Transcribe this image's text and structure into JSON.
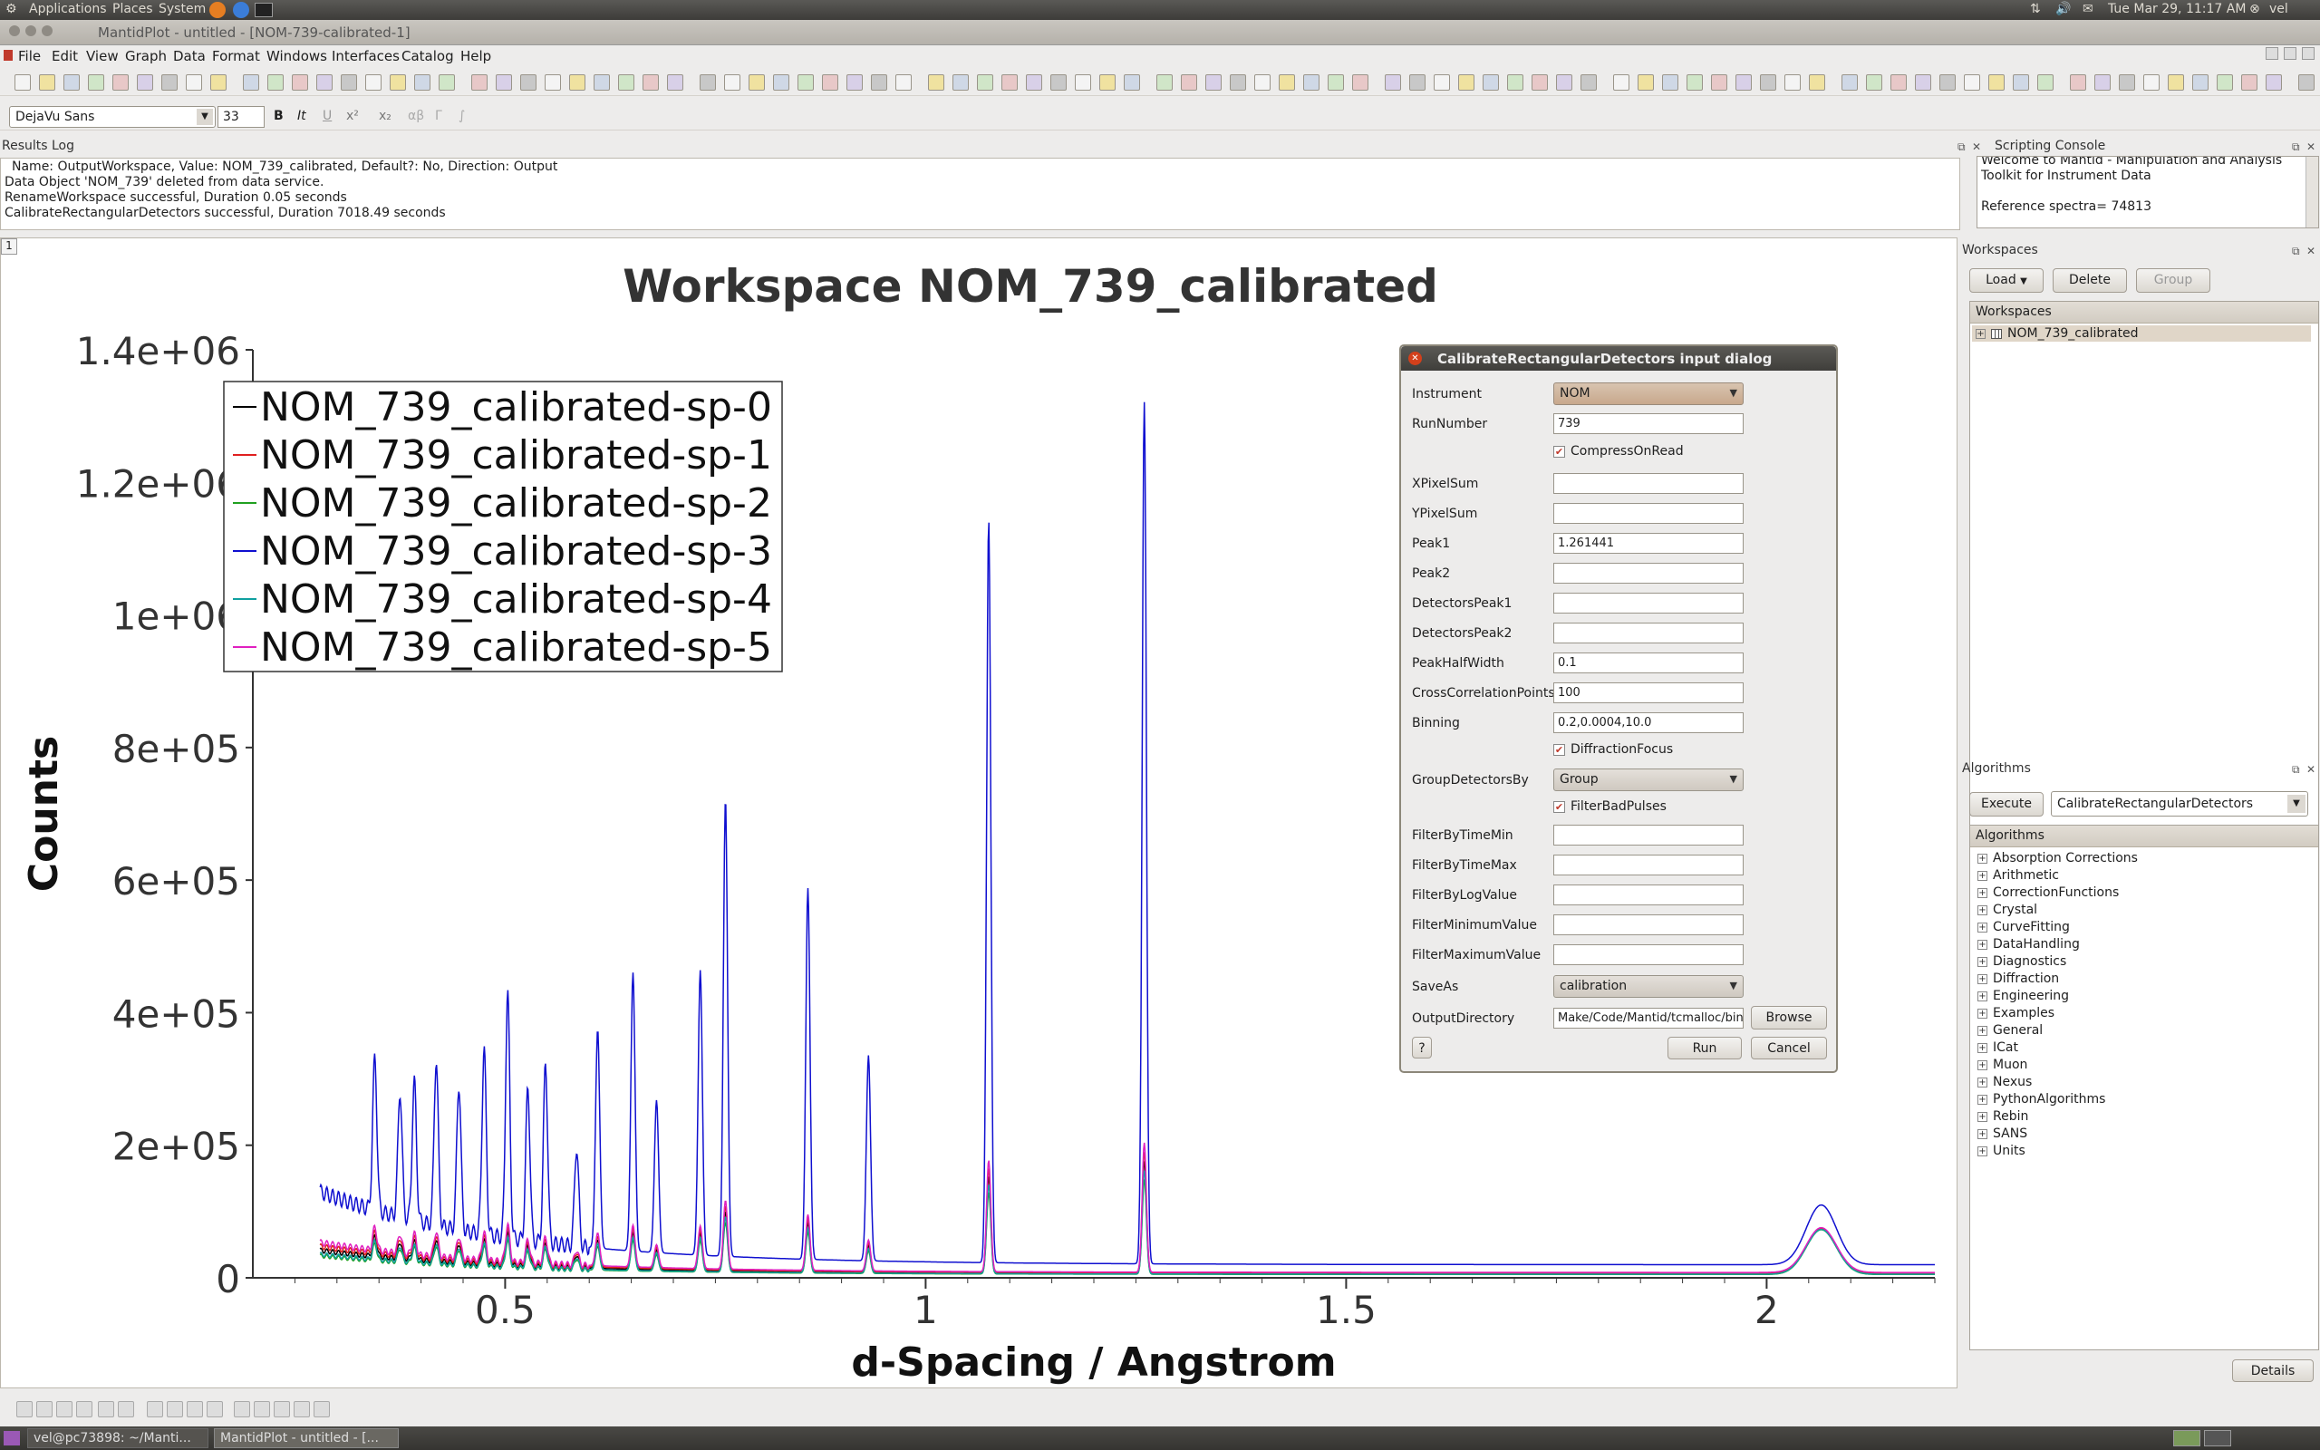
{
  "gnome_panel": {
    "menus": [
      "Applications",
      "Places",
      "System"
    ],
    "datetime": "Tue Mar 29, 11:17 AM",
    "user": "vel"
  },
  "window": {
    "title": "MantidPlot - untitled - [NOM-739-calibrated-1]"
  },
  "menubar": [
    "File",
    "Edit",
    "View",
    "Graph",
    "Data",
    "Format",
    "Windows",
    "Interfaces",
    "Catalog",
    "Help"
  ],
  "format_bar": {
    "font_family": "DejaVu Sans",
    "font_size": "33",
    "bold": "B",
    "italic": "It",
    "underline": "U",
    "superscript": "x²",
    "subscript": "x₂",
    "greek_lower": "αβ",
    "greek_upper": "Γ",
    "integral": "∫"
  },
  "results_log": {
    "title": "Results Log",
    "lines": [
      "Name: OutputWorkspace, Value: NOM_739_calibrated, Default?: No, Direction: Output",
      "Data Object 'NOM_739' deleted from data service.",
      "RenameWorkspace successful, Duration 0.05 seconds",
      "CalibrateRectangularDetectors successful, Duration 7018.49 seconds"
    ]
  },
  "scripting_console": {
    "title": "Scripting Console",
    "lines": [
      "Welcome to Mantid - Manipulation and Analysis",
      "Toolkit for Instrument Data",
      "",
      "Reference spectra= 74813"
    ]
  },
  "workspaces_panel": {
    "title": "Workspaces",
    "load": "Load",
    "delete": "Delete",
    "group": "Group",
    "tree_header": "Workspaces",
    "items": [
      "NOM_739_calibrated"
    ]
  },
  "algorithms_panel": {
    "title": "Algorithms",
    "execute": "Execute",
    "selected": "CalibrateRectangularDetectors",
    "tree_header": "Algorithms",
    "categories": [
      "Absorption Corrections",
      "Arithmetic",
      "CorrectionFunctions",
      "Crystal",
      "CurveFitting",
      "DataHandling",
      "Diagnostics",
      "Diffraction",
      "Engineering",
      "Examples",
      "General",
      "ICat",
      "Muon",
      "Nexus",
      "PythonAlgorithms",
      "Rebin",
      "SANS",
      "Units"
    ],
    "details": "Details"
  },
  "plot_window": {
    "index_label": "1"
  },
  "dialog": {
    "title": "CalibrateRectangularDetectors input dialog",
    "fields": {
      "instrument": {
        "label": "Instrument",
        "value": "NOM"
      },
      "run_number": {
        "label": "RunNumber",
        "value": "739"
      },
      "compress_on_read": {
        "label": "CompressOnRead",
        "checked": true
      },
      "x_pixel_sum": {
        "label": "XPixelSum",
        "value": ""
      },
      "y_pixel_sum": {
        "label": "YPixelSum",
        "value": ""
      },
      "peak1": {
        "label": "Peak1",
        "value": "1.261441"
      },
      "peak2": {
        "label": "Peak2",
        "value": ""
      },
      "detectors_peak1": {
        "label": "DetectorsPeak1",
        "value": ""
      },
      "detectors_peak2": {
        "label": "DetectorsPeak2",
        "value": ""
      },
      "peak_half_width": {
        "label": "PeakHalfWidth",
        "value": "0.1"
      },
      "cross_correlation_points": {
        "label": "CrossCorrelationPoints",
        "value": "100"
      },
      "binning": {
        "label": "Binning",
        "value": "0.2,0.0004,10.0"
      },
      "diffraction_focus": {
        "label": "DiffractionFocus",
        "checked": true
      },
      "group_detectors_by": {
        "label": "GroupDetectorsBy",
        "value": "Group"
      },
      "filter_bad_pulses": {
        "label": "FilterBadPulses",
        "checked": true
      },
      "filter_by_time_min": {
        "label": "FilterByTimeMin",
        "value": ""
      },
      "filter_by_time_max": {
        "label": "FilterByTimeMax",
        "value": ""
      },
      "filter_by_log_value": {
        "label": "FilterByLogValue",
        "value": ""
      },
      "filter_minimum_value": {
        "label": "FilterMinimumValue",
        "value": ""
      },
      "filter_maximum_value": {
        "label": "FilterMaximumValue",
        "value": ""
      },
      "save_as": {
        "label": "SaveAs",
        "value": "calibration"
      },
      "output_directory": {
        "label": "OutputDirectory",
        "value": "Make/Code/Mantid/tcmalloc/bin"
      }
    },
    "browse": "Browse",
    "help": "?",
    "run": "Run",
    "cancel": "Cancel"
  },
  "taskbar": {
    "items": [
      "vel@pc73898: ~/Manti...",
      "MantidPlot - untitled - [..."
    ]
  },
  "chart_data": {
    "type": "line",
    "title": "Workspace NOM_739_calibrated",
    "xlabel": "d-Spacing / Angstrom",
    "ylabel": "Counts",
    "xlim": [
      0.2,
      2.2
    ],
    "ylim": [
      0,
      1400000
    ],
    "xticks": [
      0.5,
      1,
      1.5,
      2
    ],
    "xtick_labels": [
      "0.5",
      "1",
      "1.5",
      "2"
    ],
    "yticks": [
      0,
      200000,
      400000,
      600000,
      800000,
      1000000,
      1200000,
      1400000
    ],
    "ytick_labels": [
      "0",
      "2e+05",
      "4e+05",
      "6e+05",
      "8e+05",
      "1e+06",
      "1.2e+06",
      "1.4e+06"
    ],
    "legend_position": "top-left",
    "series": [
      {
        "name": "NOM_739_calibrated-sp-0",
        "color": "#000000",
        "baseline": 35000,
        "peak_scale": 0.13
      },
      {
        "name": "NOM_739_calibrated-sp-1",
        "color": "#e02020",
        "baseline": 40000,
        "peak_scale": 0.14
      },
      {
        "name": "NOM_739_calibrated-sp-2",
        "color": "#20a020",
        "baseline": 28000,
        "peak_scale": 0.11
      },
      {
        "name": "NOM_739_calibrated-sp-3",
        "color": "#1010d0",
        "baseline": 110000,
        "peak_scale": 1.0
      },
      {
        "name": "NOM_739_calibrated-sp-4",
        "color": "#10a0a0",
        "baseline": 30000,
        "peak_scale": 0.12
      },
      {
        "name": "NOM_739_calibrated-sp-5",
        "color": "#e020c0",
        "baseline": 45000,
        "peak_scale": 0.15
      }
    ],
    "peaks": [
      {
        "x": 0.345,
        "y": 270000
      },
      {
        "x": 0.375,
        "y": 230000
      },
      {
        "x": 0.392,
        "y": 250000
      },
      {
        "x": 0.418,
        "y": 290000
      },
      {
        "x": 0.445,
        "y": 260000
      },
      {
        "x": 0.475,
        "y": 320000
      },
      {
        "x": 0.503,
        "y": 410000
      },
      {
        "x": 0.527,
        "y": 270000
      },
      {
        "x": 0.548,
        "y": 310000
      },
      {
        "x": 0.585,
        "y": 190000
      },
      {
        "x": 0.61,
        "y": 370000
      },
      {
        "x": 0.652,
        "y": 460000
      },
      {
        "x": 0.68,
        "y": 270000
      },
      {
        "x": 0.732,
        "y": 470000
      },
      {
        "x": 0.762,
        "y": 730000
      },
      {
        "x": 0.86,
        "y": 600000
      },
      {
        "x": 0.932,
        "y": 350000
      },
      {
        "x": 1.075,
        "y": 1160000
      },
      {
        "x": 1.26,
        "y": 1340000
      },
      {
        "x": 2.065,
        "y": 130000
      }
    ]
  }
}
